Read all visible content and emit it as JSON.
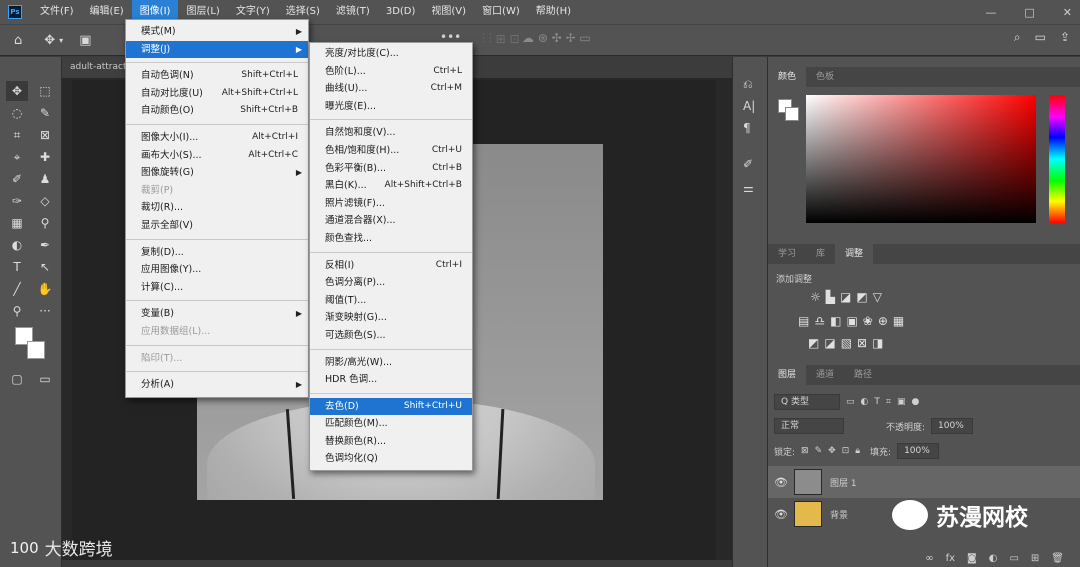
{
  "app": {
    "menubar": [
      "文件(F)",
      "编辑(E)",
      "图像(I)",
      "图层(L)",
      "文字(Y)",
      "选择(S)",
      "滤镜(T)",
      "3D(D)",
      "视图(V)",
      "窗口(W)",
      "帮助(H)"
    ],
    "active_menu_index": 2,
    "window_controls": [
      "—",
      "□",
      "✕"
    ]
  },
  "document": {
    "tab_title": "adult-attract"
  },
  "image_menu": {
    "items": [
      {
        "label": "模式(M)",
        "submenu": true
      },
      {
        "label": "调整(J)",
        "submenu": true,
        "highlighted": true
      },
      {
        "sep": true
      },
      {
        "label": "自动色调(N)",
        "shortcut": "Shift+Ctrl+L"
      },
      {
        "label": "自动对比度(U)",
        "shortcut": "Alt+Shift+Ctrl+L"
      },
      {
        "label": "自动颜色(O)",
        "shortcut": "Shift+Ctrl+B"
      },
      {
        "sep": true
      },
      {
        "label": "图像大小(I)...",
        "shortcut": "Alt+Ctrl+I"
      },
      {
        "label": "画布大小(S)...",
        "shortcut": "Alt+Ctrl+C"
      },
      {
        "label": "图像旋转(G)",
        "submenu": true
      },
      {
        "label": "裁剪(P)",
        "disabled": true
      },
      {
        "label": "裁切(R)..."
      },
      {
        "label": "显示全部(V)"
      },
      {
        "sep": true
      },
      {
        "label": "复制(D)..."
      },
      {
        "label": "应用图像(Y)..."
      },
      {
        "label": "计算(C)..."
      },
      {
        "sep": true
      },
      {
        "label": "变量(B)",
        "submenu": true
      },
      {
        "label": "应用数据组(L)...",
        "disabled": true
      },
      {
        "sep": true
      },
      {
        "label": "陷印(T)...",
        "disabled": true
      },
      {
        "sep": true
      },
      {
        "label": "分析(A)",
        "submenu": true
      }
    ]
  },
  "adjust_submenu": {
    "items": [
      {
        "label": "亮度/对比度(C)..."
      },
      {
        "label": "色阶(L)...",
        "shortcut": "Ctrl+L"
      },
      {
        "label": "曲线(U)...",
        "shortcut": "Ctrl+M"
      },
      {
        "label": "曝光度(E)..."
      },
      {
        "sep": true
      },
      {
        "label": "自然饱和度(V)..."
      },
      {
        "label": "色相/饱和度(H)...",
        "shortcut": "Ctrl+U"
      },
      {
        "label": "色彩平衡(B)...",
        "shortcut": "Ctrl+B"
      },
      {
        "label": "黑白(K)...",
        "shortcut": "Alt+Shift+Ctrl+B"
      },
      {
        "label": "照片滤镜(F)..."
      },
      {
        "label": "通道混合器(X)..."
      },
      {
        "label": "颜色查找..."
      },
      {
        "sep": true
      },
      {
        "label": "反相(I)",
        "shortcut": "Ctrl+I"
      },
      {
        "label": "色调分离(P)..."
      },
      {
        "label": "阈值(T)..."
      },
      {
        "label": "渐变映射(G)..."
      },
      {
        "label": "可选颜色(S)..."
      },
      {
        "sep": true
      },
      {
        "label": "阴影/高光(W)..."
      },
      {
        "label": "HDR 色调..."
      },
      {
        "sep": true
      },
      {
        "label": "去色(D)",
        "shortcut": "Shift+Ctrl+U",
        "highlighted": true
      },
      {
        "label": "匹配颜色(M)..."
      },
      {
        "label": "替换颜色(R)..."
      },
      {
        "label": "色调均化(Q)"
      }
    ]
  },
  "panels": {
    "color_tabs": [
      "颜色",
      "色板"
    ],
    "adjust_tabs": [
      "学习",
      "库",
      "调整"
    ],
    "adjust_title": "添加调整",
    "layers_tabs": [
      "图层",
      "通道",
      "路径"
    ],
    "kind_filter": "Q 类型",
    "blend_mode": "正常",
    "opacity_label": "不透明度:",
    "opacity_value": "100%",
    "lock_label": "锁定:",
    "fill_label": "填充:",
    "fill_value": "100%",
    "layers": [
      {
        "name": "图层 1",
        "selected": true
      },
      {
        "name": "背景",
        "selected": false
      }
    ]
  },
  "watermarks": {
    "left_logo": "100",
    "left_text": "大数跨境",
    "right_text": "苏漫网校"
  }
}
